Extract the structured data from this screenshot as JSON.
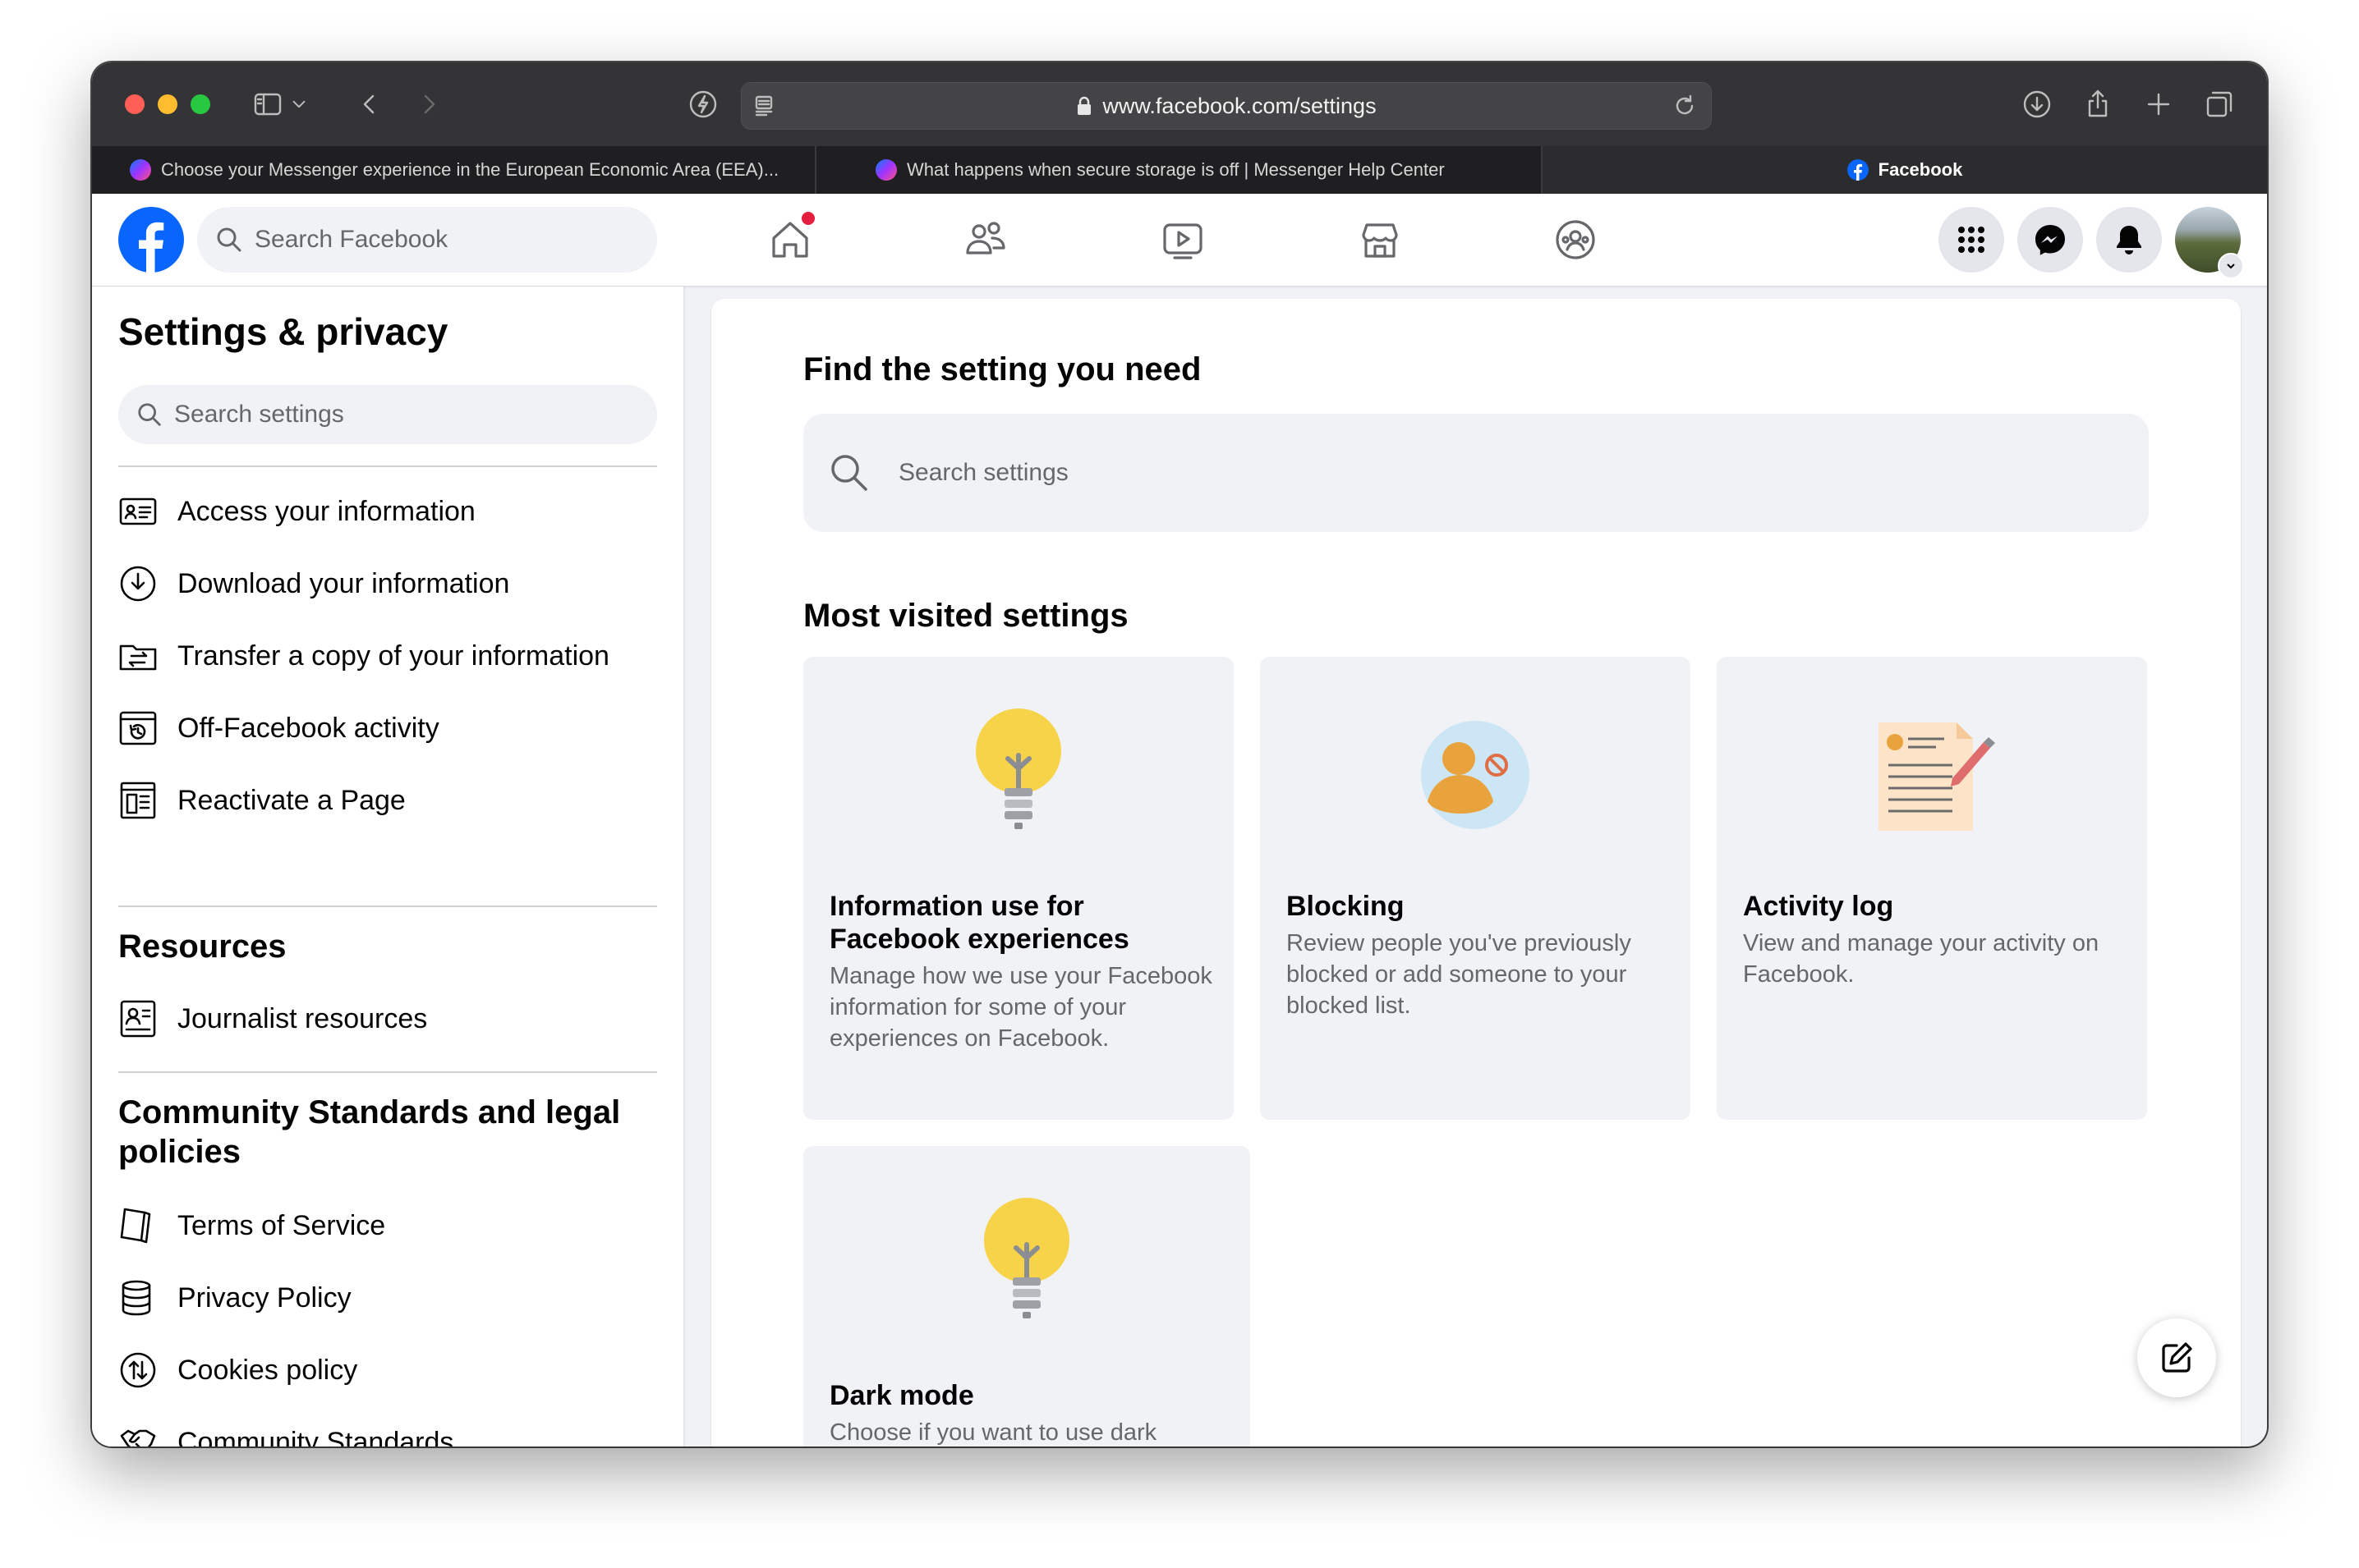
{
  "browser": {
    "url": "www.facebook.com/settings",
    "tabs": [
      {
        "title": "Choose your Messenger experience in the European Economic Area (EEA)..."
      },
      {
        "title": "What happens when secure storage is off | Messenger Help Center"
      },
      {
        "title": "Facebook"
      }
    ]
  },
  "header": {
    "search_placeholder": "Search Facebook"
  },
  "sidebar": {
    "title": "Settings & privacy",
    "search_placeholder": "Search settings",
    "items": [
      {
        "label": "Access your information",
        "icon": "id-card-icon"
      },
      {
        "label": "Download your information",
        "icon": "download-circle-icon"
      },
      {
        "label": "Transfer a copy of your information",
        "icon": "folder-transfer-icon"
      },
      {
        "label": "Off-Facebook activity",
        "icon": "history-icon"
      },
      {
        "label": "Reactivate a Page",
        "icon": "page-icon"
      }
    ],
    "resources": {
      "title": "Resources",
      "items": [
        {
          "label": "Journalist resources",
          "icon": "journalist-icon"
        }
      ]
    },
    "policies": {
      "title": "Community Standards and legal policies",
      "items": [
        {
          "label": "Terms of Service",
          "icon": "book-icon"
        },
        {
          "label": "Privacy Policy",
          "icon": "database-icon"
        },
        {
          "label": "Cookies policy",
          "icon": "cookie-icon"
        },
        {
          "label": "Community Standards",
          "icon": "handshake-icon"
        }
      ]
    }
  },
  "main": {
    "find_title": "Find the setting you need",
    "search_placeholder": "Search settings",
    "most_visited_title": "Most visited settings",
    "cards": [
      {
        "title": "Information use for Facebook experiences",
        "desc": "Manage how we use your Facebook information for some of your experiences on Facebook."
      },
      {
        "title": "Blocking",
        "desc": "Review people you've previously blocked or add someone to your blocked list."
      },
      {
        "title": "Activity log",
        "desc": "View and manage your activity on Facebook."
      },
      {
        "title": "Dark mode",
        "desc": "Choose if you want to use dark"
      }
    ]
  },
  "colors": {
    "fb_blue": "#0866ff",
    "bulb_yellow": "#f7d34a",
    "notification_red": "#e41e3f"
  }
}
